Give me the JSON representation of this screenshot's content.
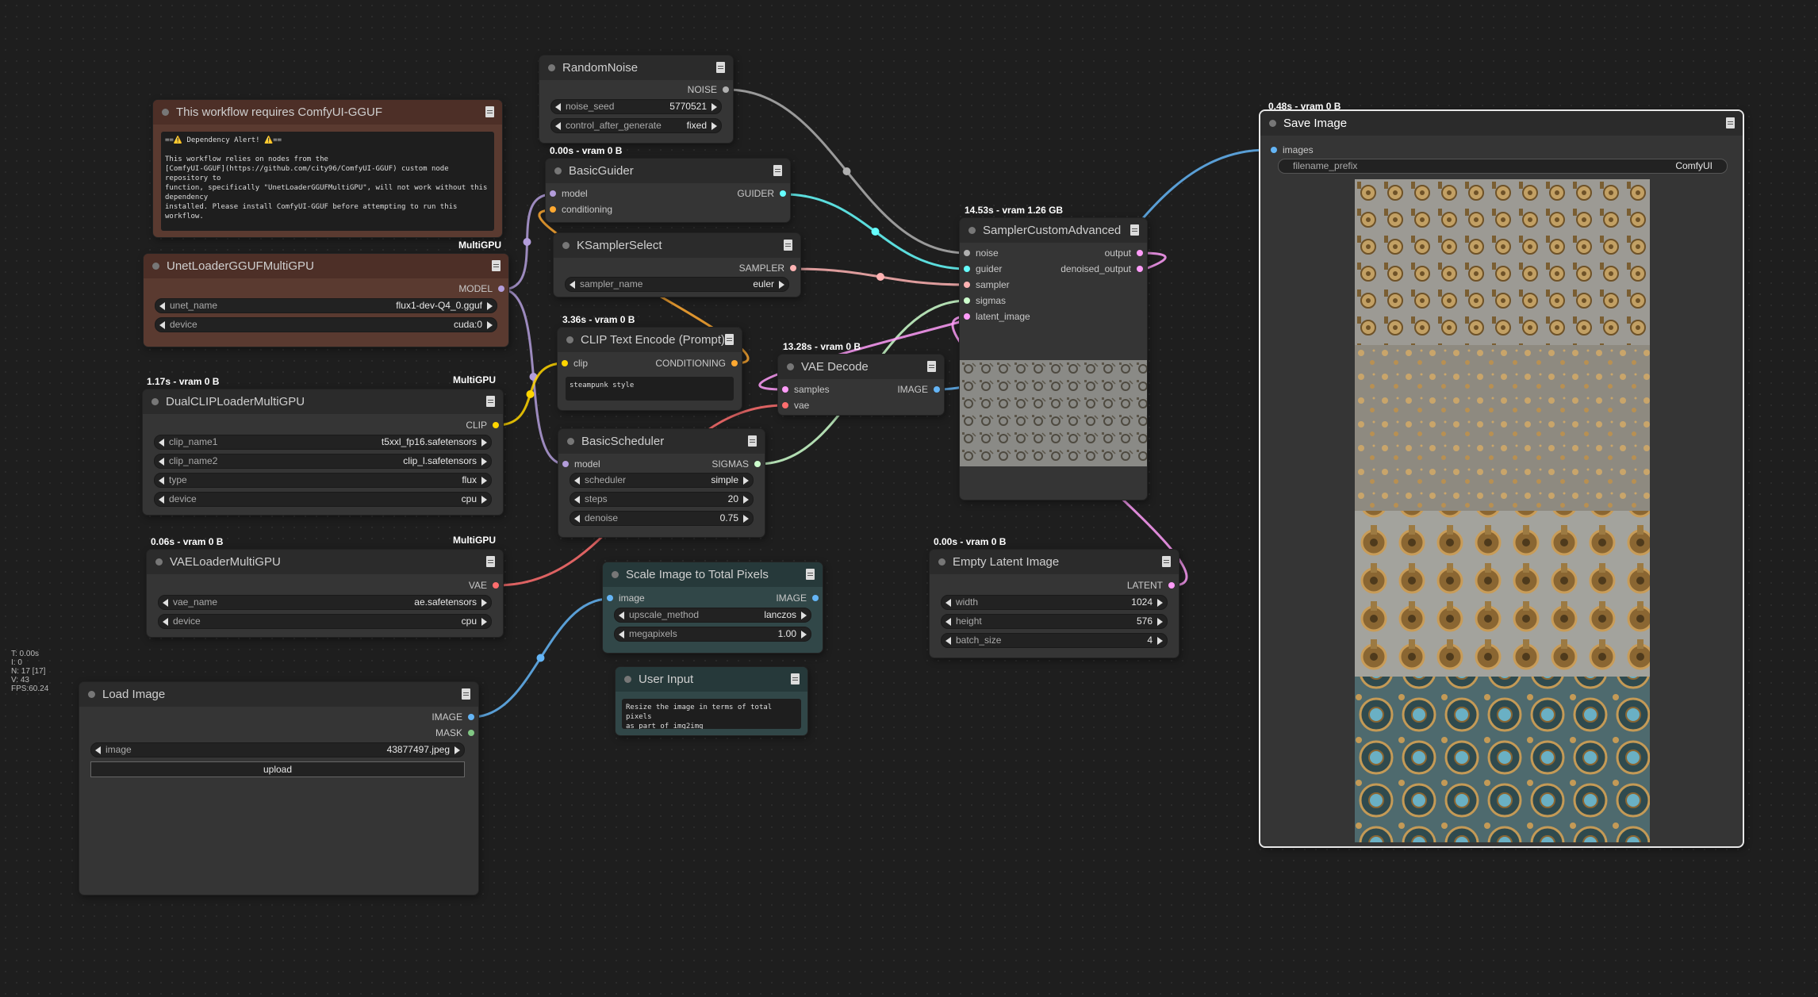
{
  "stats": [
    "T: 0.00s",
    "I: 0",
    "N: 17 [17]",
    "V: 43",
    "FPS:60.24"
  ],
  "notice": {
    "title": "This workflow requires ComfyUI-GGUF",
    "text": "==⚠️ Dependency Alert! ⚠️==\n\nThis workflow relies on nodes from the\n[ComfyUI-GGUF](https://github.com/city96/ComfyUI-GGUF) custom node repository to\nfunction, specifically \"UnetLoaderGGUFMultiGPU\", will not work without this dependency\ninstalled. Please install ComfyUI-GGUF before attempting to run this workflow."
  },
  "unet": {
    "group": "MultiGPU",
    "title": "UnetLoaderGGUFMultiGPU",
    "out": "MODEL",
    "widgets": [
      {
        "label": "unet_name",
        "value": "flux1-dev-Q4_0.gguf"
      },
      {
        "label": "device",
        "value": "cuda:0"
      }
    ]
  },
  "clip_loader": {
    "badge": "1.17s - vram 0 B",
    "group": "MultiGPU",
    "title": "DualCLIPLoaderMultiGPU",
    "out": "CLIP",
    "widgets": [
      {
        "label": "clip_name1",
        "value": "t5xxl_fp16.safetensors"
      },
      {
        "label": "clip_name2",
        "value": "clip_l.safetensors"
      },
      {
        "label": "type",
        "value": "flux"
      },
      {
        "label": "device",
        "value": "cpu"
      }
    ]
  },
  "vae_loader": {
    "badge": "0.06s - vram 0 B",
    "group": "MultiGPU",
    "title": "VAELoaderMultiGPU",
    "out": "VAE",
    "widgets": [
      {
        "label": "vae_name",
        "value": "ae.safetensors"
      },
      {
        "label": "device",
        "value": "cpu"
      }
    ]
  },
  "load_image": {
    "title": "Load Image",
    "outs": [
      "IMAGE",
      "MASK"
    ],
    "widget": {
      "label": "image",
      "value": "43877497.jpeg"
    },
    "upload": "upload"
  },
  "random_noise": {
    "title": "RandomNoise",
    "out": "NOISE",
    "widgets": [
      {
        "label": "noise_seed",
        "value": "5770521"
      },
      {
        "label": "control_after_generate",
        "value": "fixed"
      }
    ]
  },
  "guider": {
    "badge": "0.00s - vram 0 B",
    "title": "BasicGuider",
    "ins": [
      "model",
      "conditioning"
    ],
    "out": "GUIDER"
  },
  "ksampler_select": {
    "title": "KSamplerSelect",
    "out": "SAMPLER",
    "widget": {
      "label": "sampler_name",
      "value": "euler"
    }
  },
  "clip_encode": {
    "badge": "3.36s - vram 0 B",
    "title": "CLIP Text Encode (Prompt)",
    "in": "clip",
    "out": "CONDITIONING",
    "text": "steampunk style"
  },
  "scheduler": {
    "title": "BasicScheduler",
    "in": "model",
    "out": "SIGMAS",
    "widgets": [
      {
        "label": "scheduler",
        "value": "simple"
      },
      {
        "label": "steps",
        "value": "20"
      },
      {
        "label": "denoise",
        "value": "0.75"
      }
    ]
  },
  "scale_image": {
    "title": "Scale Image to Total Pixels",
    "in": "image",
    "out": "IMAGE",
    "widgets": [
      {
        "label": "upscale_method",
        "value": "lanczos"
      },
      {
        "label": "megapixels",
        "value": "1.00"
      }
    ]
  },
  "user_input": {
    "title": "User Input",
    "text": "Resize the image in terms of total pixels\nas part of img2img"
  },
  "vae_decode": {
    "badge": "13.28s - vram 0 B",
    "title": "VAE Decode",
    "ins": [
      "samples",
      "vae"
    ],
    "out": "IMAGE"
  },
  "sampler": {
    "badge": "14.53s - vram 1.26 GB",
    "title": "SamplerCustomAdvanced",
    "ins": [
      "noise",
      "guider",
      "sampler",
      "sigmas",
      "latent_image"
    ],
    "outs": [
      "output",
      "denoised_output"
    ]
  },
  "latent": {
    "badge": "0.00s - vram 0 B",
    "title": "Empty Latent Image",
    "out": "LATENT",
    "widgets": [
      {
        "label": "width",
        "value": "1024"
      },
      {
        "label": "height",
        "value": "576"
      },
      {
        "label": "batch_size",
        "value": "4"
      }
    ]
  },
  "save": {
    "badge": "0.48s - vram 0 B",
    "title": "Save Image",
    "in": "images",
    "widget": {
      "label": "filename_prefix",
      "value": "ComfyUI"
    }
  },
  "colors": {
    "model": "#b39ddb",
    "clip": "#ffd500",
    "vae": "#ff6e6e",
    "image": "#64b5f6",
    "latent": "#ff9cf9",
    "conditioning": "#ffa931",
    "noise": "#b0b0b0",
    "guider": "#66ffff",
    "sampler": "#ffb3b3",
    "sigmas": "#cdffcd"
  }
}
